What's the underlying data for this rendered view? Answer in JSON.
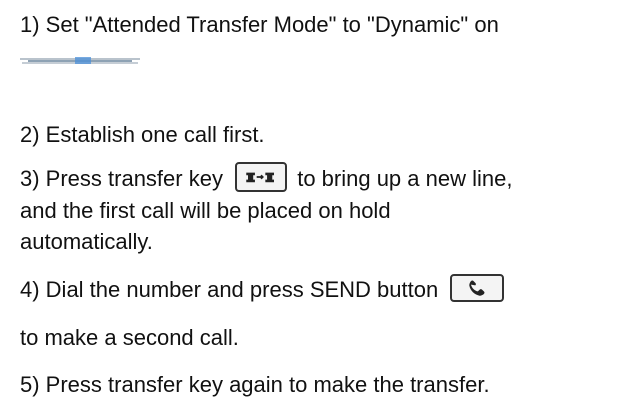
{
  "steps": {
    "step1": "1) Set \"Attended Transfer Mode\" to \"Dynamic\" on",
    "step2": "2) Establish one call  first.",
    "step3_a": "3) Press transfer key",
    "step3_b": "to bring up a new line,",
    "step3_c": "and the first call will be placed on hold",
    "step3_d": "automatically.",
    "step4_a": "4) Dial the number and press SEND button",
    "step4_b": "to make a second call.",
    "step5": "5) Press transfer key again to make the transfer."
  },
  "icons": {
    "transfer_key": "transfer-key-icon",
    "send_button": "send-button-icon",
    "inline_link_image": "blurred-link-image"
  }
}
